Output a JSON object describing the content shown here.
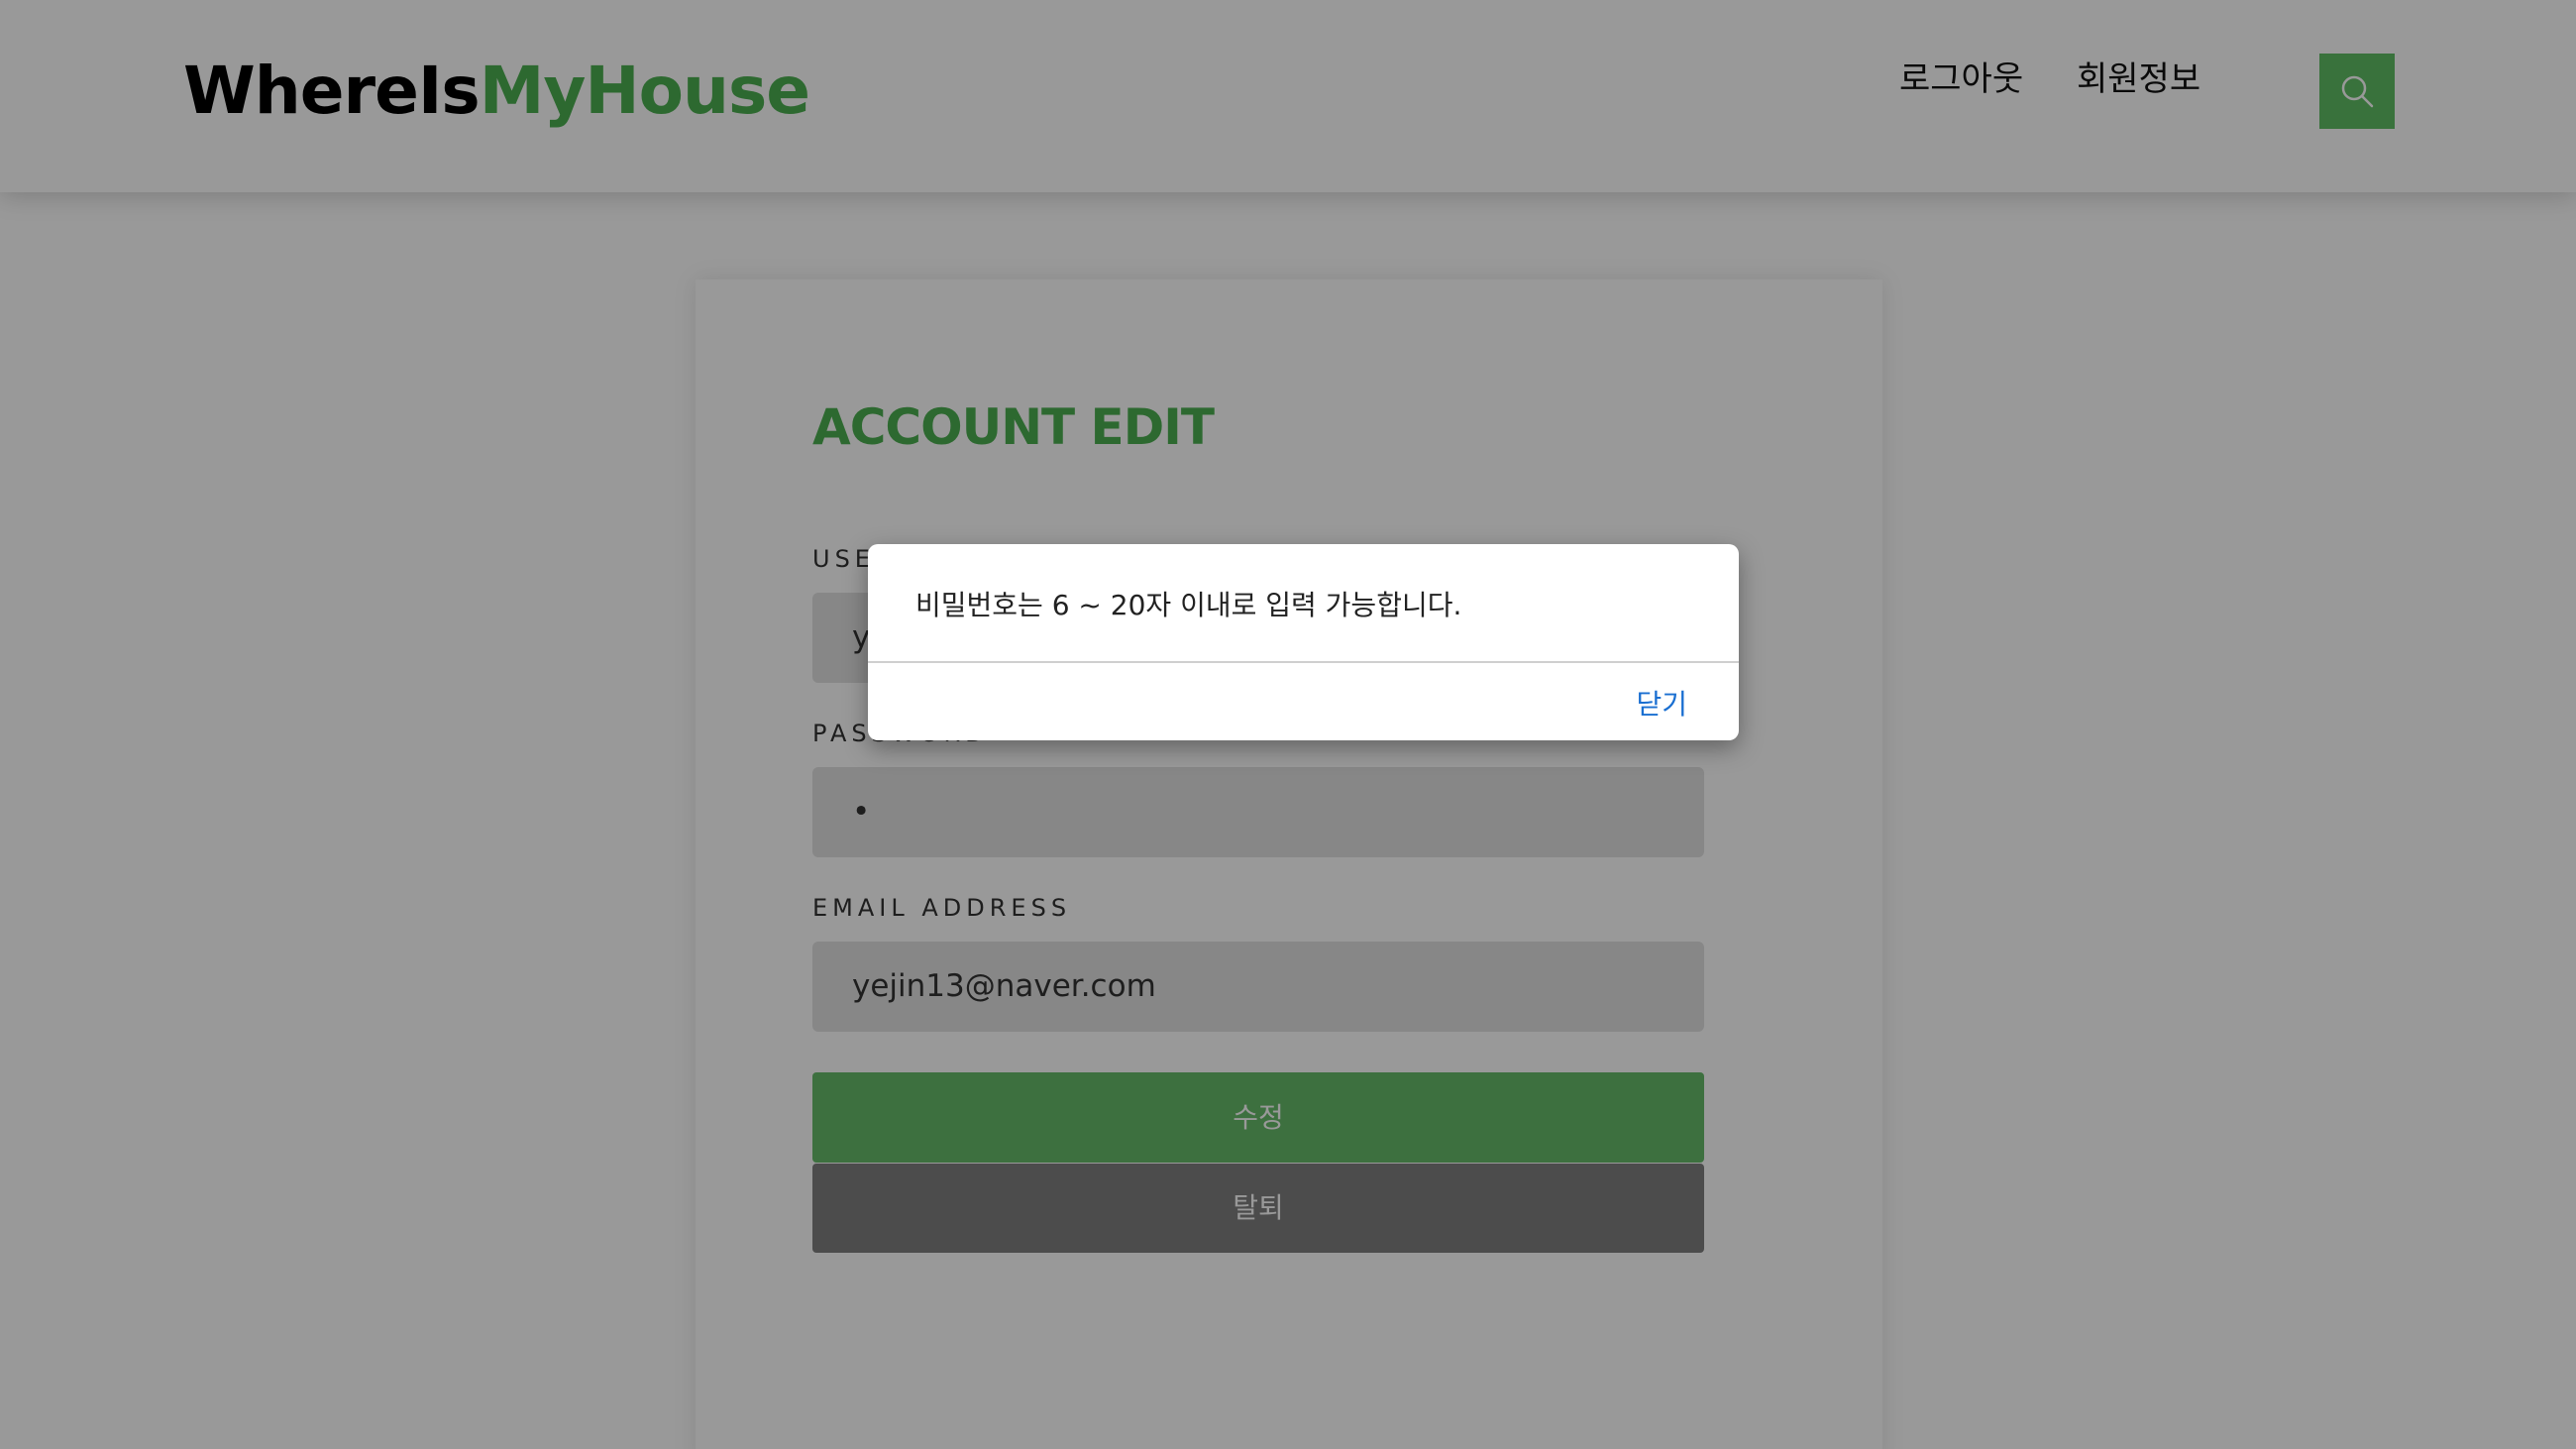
{
  "header": {
    "logo_part1": "WhereIs",
    "logo_part2": "MyHouse",
    "nav_logout": "로그아웃",
    "nav_profile": "회원정보",
    "search_icon": "search-icon"
  },
  "form": {
    "title": "ACCOUNT EDIT",
    "username_label": "USERNAME",
    "username_value": "y",
    "password_label": "PASSWORD",
    "password_value": "•",
    "email_label": "EMAIL ADDRESS",
    "email_value": "yejin13@naver.com",
    "edit_button": "수정",
    "withdraw_button": "탈퇴"
  },
  "dialog": {
    "message": "비밀번호는 6 ~ 20자 이내로 입력 가능합니다.",
    "close_label": "닫기"
  },
  "colors": {
    "accent": "#4caf50",
    "button_green": "#66bb6a",
    "button_gray": "#7f7f7f",
    "dialog_link": "#1a6fd1"
  }
}
